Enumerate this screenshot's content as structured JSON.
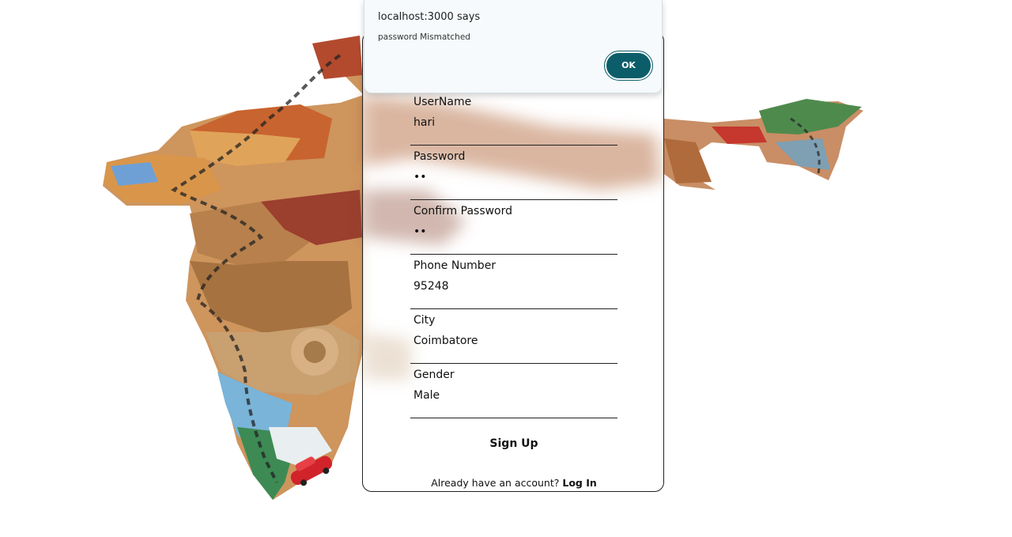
{
  "dialog": {
    "title": "localhost:3000 says",
    "message": "password Mismatched",
    "ok_label": "OK"
  },
  "form": {
    "fields": [
      {
        "label": "UserName",
        "value": "hari"
      },
      {
        "label": "Password",
        "value": "••"
      },
      {
        "label": "Confirm Password",
        "value": "••"
      },
      {
        "label": "Phone Number",
        "value": "95248"
      },
      {
        "label": "City",
        "value": "Coimbatore"
      },
      {
        "label": "Gender",
        "value": "Male"
      }
    ],
    "signup_label": "Sign Up",
    "login_prompt": "Already have an account?",
    "login_link": "Log In"
  },
  "colors": {
    "dialog_bg": "#f6fafc",
    "ok_button": "#0b5d69",
    "card_border": "#222222"
  }
}
